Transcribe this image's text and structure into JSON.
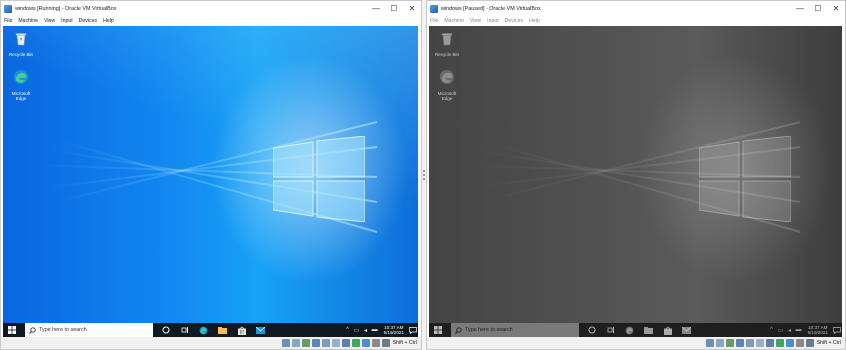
{
  "running": {
    "title": "windows [Running] - Oracle VM VirtualBox",
    "menu": [
      "File",
      "Machine",
      "View",
      "Input",
      "Devices",
      "Help"
    ],
    "desktop_icons": [
      {
        "label": "Recycle Bin"
      },
      {
        "label": "Microsoft Edge"
      }
    ],
    "search_placeholder": "Type here to search",
    "clock_time": "10:37 AM",
    "clock_date": "5/19/2021",
    "host_key": "Shift + Ctrl"
  },
  "paused": {
    "title": "windows [Paused] - Oracle VM VirtualBox",
    "menu": [
      "File",
      "Machine",
      "View",
      "Input",
      "Devices",
      "Help"
    ],
    "desktop_icons": [
      {
        "label": "Recycle Bin"
      },
      {
        "label": "Microsoft Edge"
      }
    ],
    "search_placeholder": "Type here to search",
    "clock_time": "10:37 AM",
    "clock_date": "5/19/2021",
    "host_key": "Shift + Ctrl"
  },
  "window_controls": {
    "minimize": "—",
    "maximize": "☐",
    "close": "✕"
  },
  "icons": [
    "virtualbox-app-icon",
    "recycle-bin-icon",
    "edge-icon",
    "windows-start-icon",
    "search-icon",
    "cortana-icon",
    "task-view-icon",
    "file-explorer-icon",
    "store-icon",
    "mail-icon",
    "notification-icon"
  ],
  "colors": {
    "running_accent": "#1288f0",
    "paused_tone": "#555555",
    "taskbar": "#101820"
  }
}
